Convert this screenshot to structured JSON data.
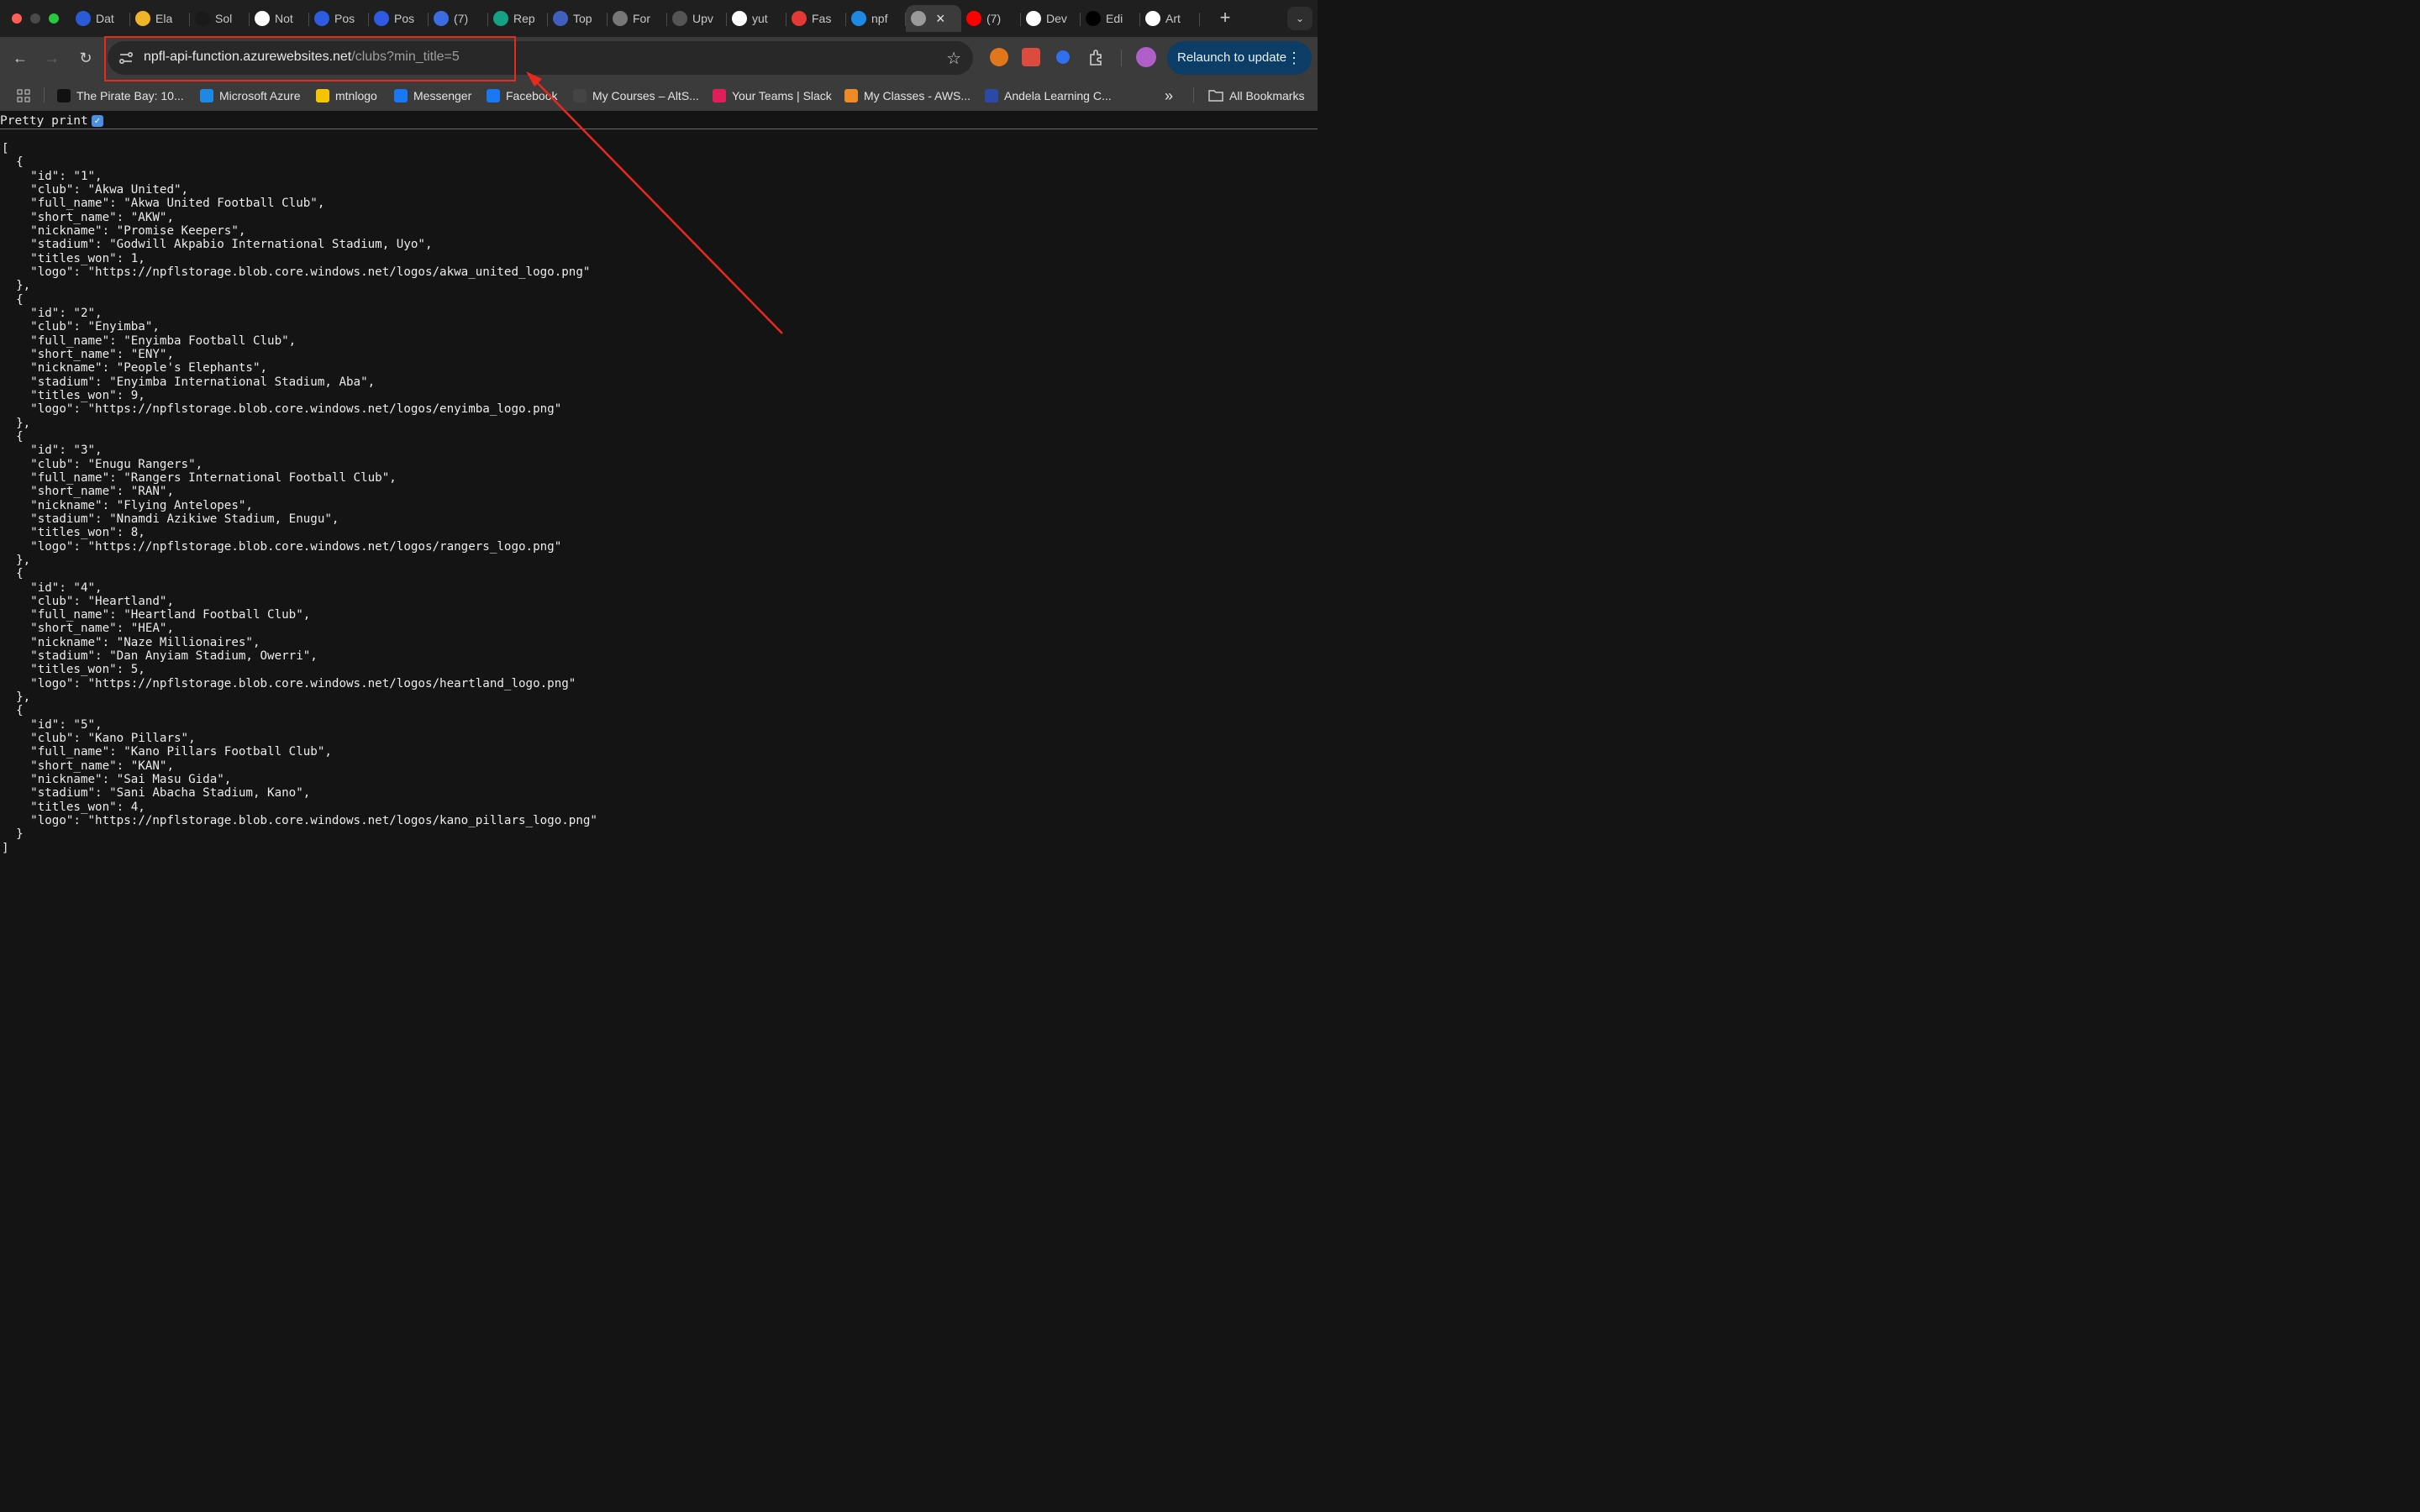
{
  "tabs": [
    {
      "title": "Dat",
      "icon": "c-logo-icon",
      "color": "#2a5bd7"
    },
    {
      "title": "Ela",
      "icon": "elastic-icon",
      "color": "#f0b429"
    },
    {
      "title": "Sol",
      "icon": "ng-logo-icon",
      "color": "#1a1a1a"
    },
    {
      "title": "Not",
      "icon": "notion-icon",
      "color": "#ffffff"
    },
    {
      "title": "Pos",
      "icon": "zoom-icon",
      "color": "#2d5be3"
    },
    {
      "title": "Pos",
      "icon": "zoom-icon",
      "color": "#2d5be3"
    },
    {
      "title": "(7)",
      "icon": "g7-icon",
      "color": "#3b6de0"
    },
    {
      "title": "Rep",
      "icon": "replit-icon",
      "color": "#16a085"
    },
    {
      "title": "Top",
      "icon": "eye-icon",
      "color": "#4060c0"
    },
    {
      "title": "For",
      "icon": "audio-wave-icon",
      "color": "#777777"
    },
    {
      "title": "Upv",
      "icon": "upwork-icon",
      "color": "#555555"
    },
    {
      "title": "yut",
      "icon": "github-icon",
      "color": "#ffffff"
    },
    {
      "title": "Fas",
      "icon": "fast-icon",
      "color": "#e53935"
    },
    {
      "title": "npf",
      "icon": "azure-icon",
      "color": "#1e88e5"
    },
    {
      "title": "",
      "icon": "globe-icon",
      "color": "#9a9a9a",
      "active": true
    },
    {
      "title": "(7)",
      "icon": "youtube-icon",
      "color": "#ff0000"
    },
    {
      "title": "Dev",
      "icon": "chatgpt-icon",
      "color": "#ffffff"
    },
    {
      "title": "Edi",
      "icon": "dev-icon",
      "color": "#000000"
    },
    {
      "title": "Art",
      "icon": "chatgpt-icon",
      "color": "#ffffff"
    }
  ],
  "toolbar": {
    "url_host": "npfl-api-function.azurewebsites.net",
    "url_path": "/clubs?min_title=5",
    "relaunch_label": "Relaunch to update"
  },
  "bookmarks": [
    {
      "label": "The Pirate Bay: 10...",
      "icon": "medium-icon",
      "color": "#111111"
    },
    {
      "label": "Microsoft Azure",
      "icon": "azure-icon",
      "color": "#1e88e5"
    },
    {
      "label": "mtnlogo",
      "icon": "mtn-icon",
      "color": "#f5c400"
    },
    {
      "label": "Messenger",
      "icon": "facebook-icon",
      "color": "#1877f2"
    },
    {
      "label": "Facebook",
      "icon": "facebook-icon",
      "color": "#1877f2"
    },
    {
      "label": "My Courses – AltS...",
      "icon": "altschool-icon",
      "color": "#444444"
    },
    {
      "label": "Your Teams | Slack",
      "icon": "slack-icon",
      "color": "#e01e5a"
    },
    {
      "label": "My Classes - AWS...",
      "icon": "aws-box-icon",
      "color": "#f08a24"
    },
    {
      "label": "Andela Learning C...",
      "icon": "andela-icon",
      "color": "#2b4aa8"
    }
  ],
  "all_bookmarks_label": "All Bookmarks",
  "pretty_print_label": "Pretty print",
  "clubs": [
    {
      "id": "1",
      "club": "Akwa United",
      "full_name": "Akwa United Football Club",
      "short_name": "AKW",
      "nickname": "Promise Keepers",
      "stadium": "Godwill Akpabio International Stadium, Uyo",
      "titles_won": 1,
      "logo": "https://npflstorage.blob.core.windows.net/logos/akwa_united_logo.png"
    },
    {
      "id": "2",
      "club": "Enyimba",
      "full_name": "Enyimba Football Club",
      "short_name": "ENY",
      "nickname": "People's Elephants",
      "stadium": "Enyimba International Stadium, Aba",
      "titles_won": 9,
      "logo": "https://npflstorage.blob.core.windows.net/logos/enyimba_logo.png"
    },
    {
      "id": "3",
      "club": "Enugu Rangers",
      "full_name": "Rangers International Football Club",
      "short_name": "RAN",
      "nickname": "Flying Antelopes",
      "stadium": "Nnamdi Azikiwe Stadium, Enugu",
      "titles_won": 8,
      "logo": "https://npflstorage.blob.core.windows.net/logos/rangers_logo.png"
    },
    {
      "id": "4",
      "club": "Heartland",
      "full_name": "Heartland Football Club",
      "short_name": "HEA",
      "nickname": "Naze Millionaires",
      "stadium": "Dan Anyiam Stadium, Owerri",
      "titles_won": 5,
      "logo": "https://npflstorage.blob.core.windows.net/logos/heartland_logo.png"
    },
    {
      "id": "5",
      "club": "Kano Pillars",
      "full_name": "Kano Pillars Football Club",
      "short_name": "KAN",
      "nickname": "Sai Masu Gida",
      "stadium": "Sani Abacha Stadium, Kano",
      "titles_won": 4,
      "logo": "https://npflstorage.blob.core.windows.net/logos/kano_pillars_logo.png"
    }
  ],
  "annotation_color": "#e8291c"
}
